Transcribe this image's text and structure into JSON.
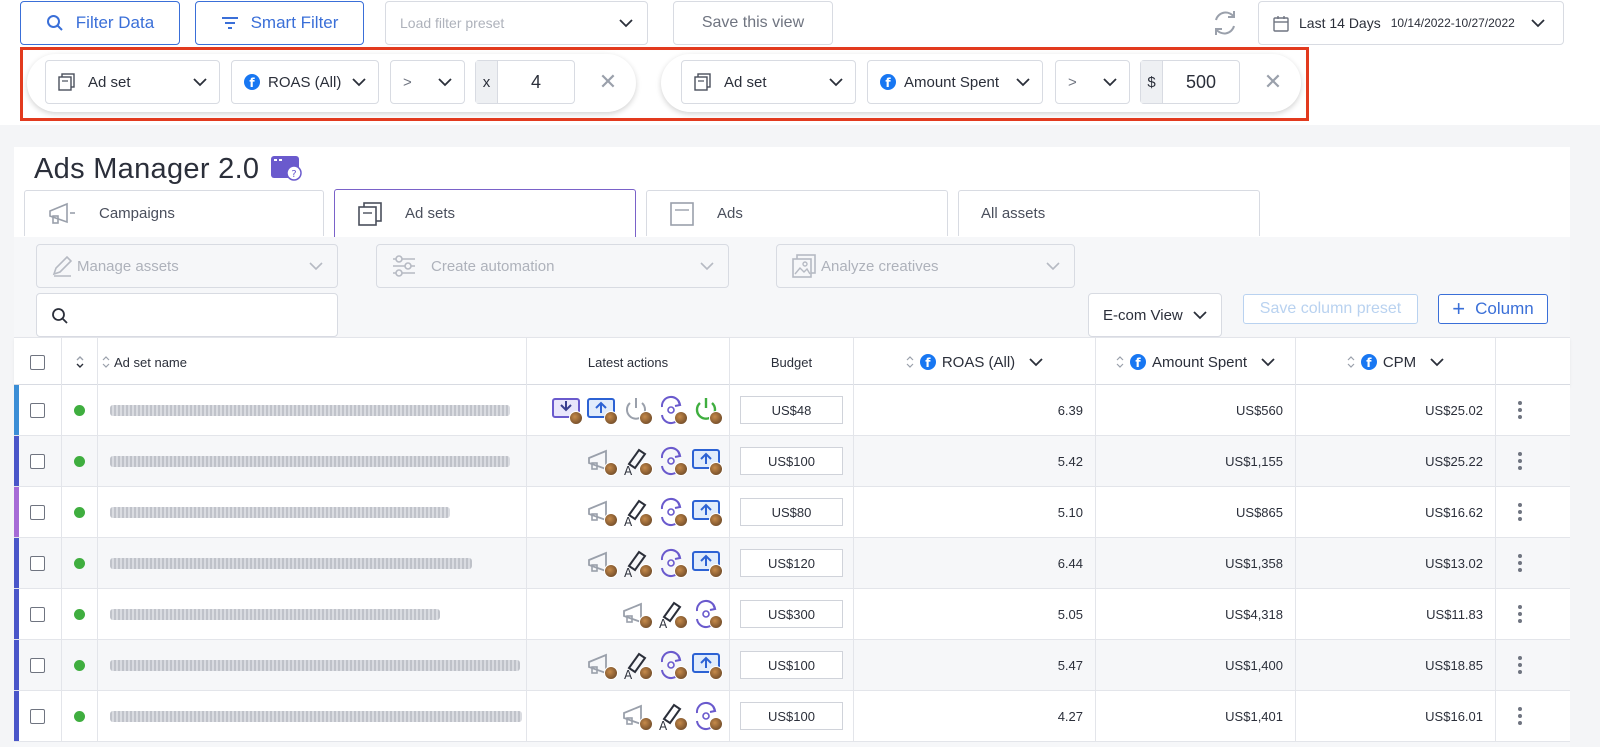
{
  "toolbar": {
    "filter_data_label": "Filter Data",
    "smart_filter_label": "Smart Filter",
    "preset_placeholder": "Load filter preset",
    "save_view_label": "Save this view",
    "date_label": "Last 14 Days",
    "date_range": "10/14/2022-10/27/2022"
  },
  "filters": [
    {
      "level": "Ad set",
      "metric": "ROAS (All)",
      "operator": ">",
      "prefix": "x",
      "value": "4"
    },
    {
      "level": "Ad set",
      "metric": "Amount Spent",
      "operator": ">",
      "prefix": "$",
      "value": "500"
    }
  ],
  "page": {
    "title": "Ads Manager 2.0"
  },
  "tabs": [
    {
      "label": "Campaigns"
    },
    {
      "label": "Ad sets"
    },
    {
      "label": "Ads"
    },
    {
      "label": "All assets"
    }
  ],
  "actions": {
    "manage_assets": "Manage assets",
    "create_automation": "Create automation",
    "analyze_creatives": "Analyze creatives"
  },
  "view": {
    "selected": "E-com View",
    "save_column_preset": "Save column preset",
    "add_column": "Column"
  },
  "table": {
    "headers": {
      "name": "Ad set name",
      "latest_actions": "Latest actions",
      "budget": "Budget",
      "roas": "ROAS (All)",
      "amount_spent": "Amount Spent",
      "cpm": "CPM"
    },
    "rows": [
      {
        "budget": "US$48",
        "roas": "6.39",
        "spent": "US$560",
        "cpm": "US$25.02",
        "stripe": "#3b8ed6"
      },
      {
        "budget": "US$100",
        "roas": "5.42",
        "spent": "US$1,155",
        "cpm": "US$25.22",
        "stripe": "#4a56c9"
      },
      {
        "budget": "US$80",
        "roas": "5.10",
        "spent": "US$865",
        "cpm": "US$16.62",
        "stripe": "#a66bd6"
      },
      {
        "budget": "US$120",
        "roas": "6.44",
        "spent": "US$1,358",
        "cpm": "US$13.02",
        "stripe": "#4a56c9"
      },
      {
        "budget": "US$300",
        "roas": "5.05",
        "spent": "US$4,318",
        "cpm": "US$11.83",
        "stripe": "#4a56c9"
      },
      {
        "budget": "US$100",
        "roas": "5.47",
        "spent": "US$1,400",
        "cpm": "US$18.85",
        "stripe": "#4a56c9"
      },
      {
        "budget": "US$100",
        "roas": "4.27",
        "spent": "US$1,401",
        "cpm": "US$16.01",
        "stripe": "#4a56c9"
      }
    ]
  },
  "colors": {
    "accent": "#3a6fd8",
    "highlight_frame": "#e23a1e",
    "active_tab": "#7a62c9",
    "status_active": "#3fae3f"
  }
}
